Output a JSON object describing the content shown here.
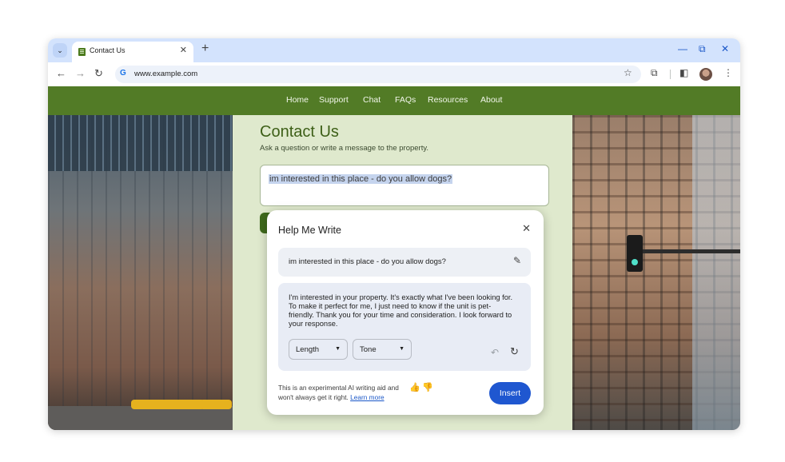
{
  "browser": {
    "tab_title": "Contact Us",
    "tab_close": "✕",
    "new_tab": "+",
    "tab_list": "⌄",
    "url": "www.example.com",
    "window_controls": {
      "minimize": "—",
      "restore": "⧉",
      "close": "✕"
    },
    "icons": {
      "back": "←",
      "forward": "→",
      "reload": "↻",
      "google": "G",
      "bookmark": "☆",
      "extensions": "⧉",
      "side_panel": "◧",
      "menu": "⋮"
    }
  },
  "site": {
    "nav": [
      "Home",
      "Support",
      "Chat",
      "FAQs",
      "Resources",
      "About"
    ],
    "title": "Contact Us",
    "subtitle": "Ask a question or write a message to the property.",
    "message": "im interested in this place - do you allow dogs?"
  },
  "help_me_write": {
    "title": "Help Me Write",
    "close": "✕",
    "prompt": "im interested in this place - do you allow dogs?",
    "edit_icon": "✎",
    "result": "I'm interested in your property. It's exactly what I've been looking for. To make it perfect for me, I just need to know if the unit is pet-friendly. Thank you for your time and consideration. I look forward to your response.",
    "length_label": "Length",
    "tone_label": "Tone",
    "caret": "▼",
    "undo": "↶",
    "redo": "↻",
    "disclaimer": "This is an experimental AI writing aid and won't always get it right.",
    "learn_more": "Learn more",
    "thumbs_up": "👍",
    "thumbs_down": "👎",
    "insert": "Insert"
  },
  "colors": {
    "site_green": "#527b26",
    "content_bg": "#dfe9cd",
    "accent_blue": "#1f57d0",
    "tabstrip": "#d3e3fd"
  }
}
